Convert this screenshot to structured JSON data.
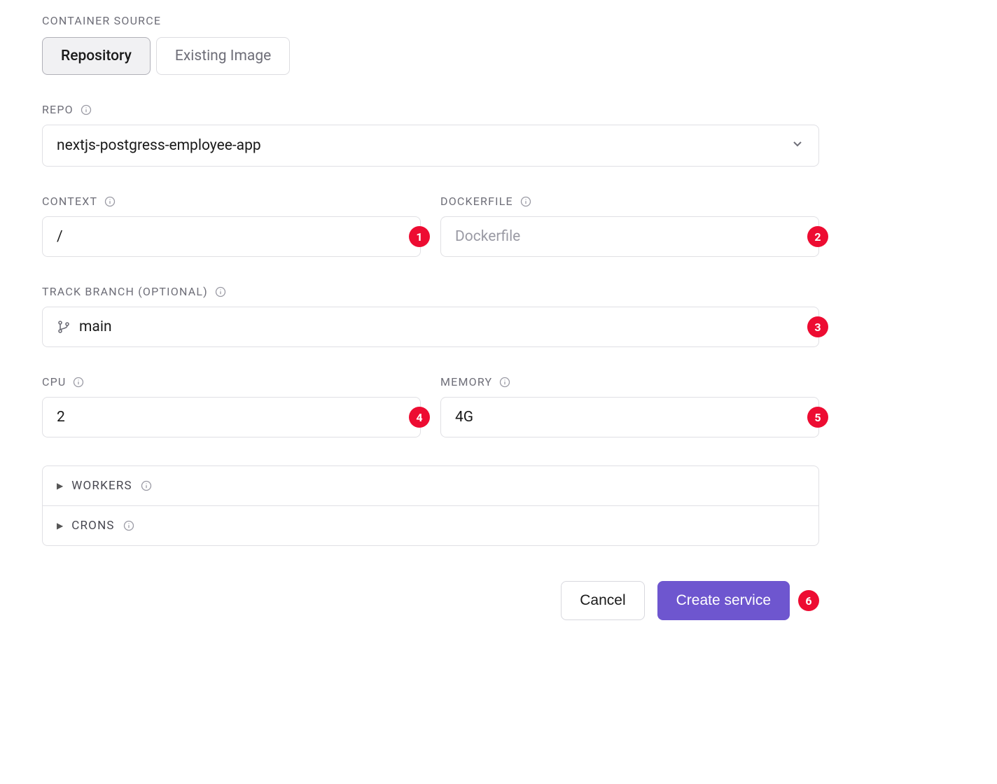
{
  "containerSource": {
    "label": "CONTAINER SOURCE",
    "tabs": [
      {
        "label": "Repository",
        "active": true
      },
      {
        "label": "Existing Image",
        "active": false
      }
    ]
  },
  "repo": {
    "label": "REPO",
    "value": "nextjs-postgress-employee-app"
  },
  "context": {
    "label": "CONTEXT",
    "value": "/",
    "badge": "1"
  },
  "dockerfile": {
    "label": "DOCKERFILE",
    "placeholder": "Dockerfile",
    "badge": "2"
  },
  "trackBranch": {
    "label": "TRACK BRANCH (OPTIONAL)",
    "value": "main",
    "badge": "3"
  },
  "cpu": {
    "label": "CPU",
    "value": "2",
    "badge": "4"
  },
  "memory": {
    "label": "MEMORY",
    "value": "4G",
    "badge": "5"
  },
  "workers": {
    "label": "WORKERS"
  },
  "crons": {
    "label": "CRONS"
  },
  "actions": {
    "cancel": "Cancel",
    "create": "Create service",
    "badge": "6"
  }
}
